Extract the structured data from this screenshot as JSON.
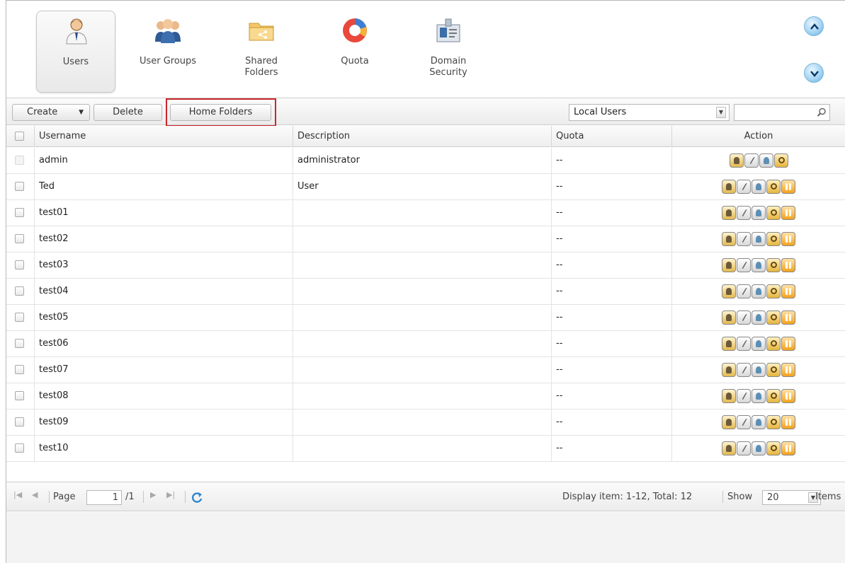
{
  "nav": {
    "items": [
      {
        "label": "Users",
        "icon": "user-icon",
        "active": true
      },
      {
        "label": "User Groups",
        "icon": "user-groups-icon",
        "active": false
      },
      {
        "label": "Shared\nFolders",
        "icon": "shared-folder-icon",
        "active": false
      },
      {
        "label": "Quota",
        "icon": "quota-pie-icon",
        "active": false
      },
      {
        "label": "Domain\nSecurity",
        "icon": "domain-security-icon",
        "active": false
      }
    ]
  },
  "toolbar": {
    "create_label": "Create",
    "delete_label": "Delete",
    "home_folders_label": "Home Folders",
    "user_type_selected": "Local Users",
    "search_value": ""
  },
  "table": {
    "columns": [
      "Username",
      "Description",
      "Quota",
      "Action"
    ],
    "rows": [
      {
        "username": "admin",
        "description": "administrator",
        "quota": "--",
        "actions": 4,
        "checkbox_enabled": false
      },
      {
        "username": "Ted",
        "description": "User",
        "quota": "--",
        "actions": 5,
        "checkbox_enabled": true
      },
      {
        "username": "test01",
        "description": "",
        "quota": "--",
        "actions": 5,
        "checkbox_enabled": true
      },
      {
        "username": "test02",
        "description": "",
        "quota": "--",
        "actions": 5,
        "checkbox_enabled": true
      },
      {
        "username": "test03",
        "description": "",
        "quota": "--",
        "actions": 5,
        "checkbox_enabled": true
      },
      {
        "username": "test04",
        "description": "",
        "quota": "--",
        "actions": 5,
        "checkbox_enabled": true
      },
      {
        "username": "test05",
        "description": "",
        "quota": "--",
        "actions": 5,
        "checkbox_enabled": true
      },
      {
        "username": "test06",
        "description": "",
        "quota": "--",
        "actions": 5,
        "checkbox_enabled": true
      },
      {
        "username": "test07",
        "description": "",
        "quota": "--",
        "actions": 5,
        "checkbox_enabled": true
      },
      {
        "username": "test08",
        "description": "",
        "quota": "--",
        "actions": 5,
        "checkbox_enabled": true
      },
      {
        "username": "test09",
        "description": "",
        "quota": "--",
        "actions": 5,
        "checkbox_enabled": true
      },
      {
        "username": "test10",
        "description": "",
        "quota": "--",
        "actions": 5,
        "checkbox_enabled": true
      }
    ]
  },
  "pager": {
    "page_label": "Page",
    "page_value": "1",
    "total_pages": "/1",
    "display_text": "Display item: 1-12, Total: 12",
    "show_label": "Show",
    "show_value": "20",
    "items_label": "Items"
  },
  "colors": {
    "highlight": "#c9262c",
    "accent": "#5aa9d8"
  }
}
